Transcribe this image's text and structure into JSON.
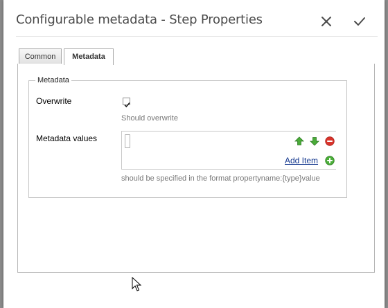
{
  "dialog": {
    "title": "Configurable metadata - Step Properties",
    "close_icon": "close-icon",
    "confirm_icon": "checkmark-icon"
  },
  "tabs": [
    {
      "label": "Common",
      "active": false
    },
    {
      "label": "Metadata",
      "active": true
    }
  ],
  "metadata_fieldset": {
    "legend": "Metadata",
    "overwrite": {
      "label": "Overwrite",
      "checked": true,
      "hint": "Should overwrite"
    },
    "metadata_values": {
      "label": "Metadata values",
      "value": "",
      "move_up_icon": "arrow-up-icon",
      "move_down_icon": "arrow-down-icon",
      "remove_icon": "remove-icon",
      "add_item_label": "Add Item",
      "add_icon": "add-icon",
      "hint": "should be specified in the format propertyname:{type}value"
    }
  },
  "colors": {
    "link": "#15398f",
    "add_green": "#4caf3a",
    "remove_red": "#d9342b",
    "arrow_green": "#3c9a2e"
  }
}
